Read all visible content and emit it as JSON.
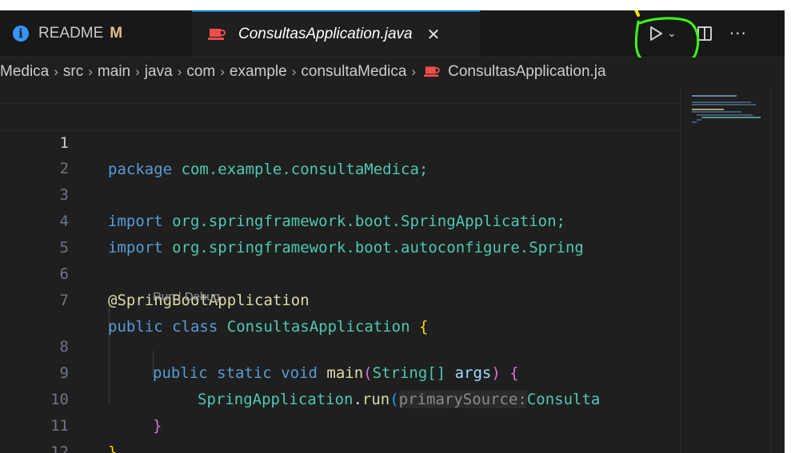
{
  "tabs": [
    {
      "label": "README",
      "badge": "M"
    },
    {
      "label": "ConsultasApplication.java",
      "close": "✕"
    }
  ],
  "actions": {
    "run_icon": "play-icon",
    "chevron": "⌄",
    "more": "···"
  },
  "breadcrumb": [
    "Medica",
    "src",
    "main",
    "java",
    "com",
    "example",
    "consultaMedica",
    "ConsultasApplication.ja"
  ],
  "breadcrumb_separator": "›",
  "gutter": {
    "line_numbers": [
      "1",
      "2",
      "3",
      "4",
      "5",
      "6",
      "7",
      "8",
      "9",
      "10",
      "11",
      "12"
    ],
    "active_line": "1"
  },
  "code": {
    "l1": {
      "kw": "package",
      "rest": " com.example.consultaMedica;"
    },
    "l3": {
      "kw": "import",
      "rest": " org.springframework.boot.SpringApplication;"
    },
    "l4": {
      "kw": "import",
      "rest": " org.springframework.boot.autoconfigure.Spring"
    },
    "l6": {
      "annotation": "@SpringBootApplication"
    },
    "l7": {
      "kw1": "public",
      "kw2": "class",
      "name": "ConsultasApplication",
      "brace": "{"
    },
    "codelens": {
      "run": "Run",
      "sep": " | ",
      "debug": "Debug"
    },
    "l8": {
      "kw1": "public",
      "kw2": "static",
      "kw3": "void",
      "fn": "main",
      "open": "(",
      "type": "String[]",
      "param": "args",
      "close": ")",
      "brace": "{"
    },
    "l9": {
      "cls": "SpringApplication",
      "dot": ".",
      "fn": "run",
      "open": "(",
      "hint": "primarySource:",
      "arg": "Consulta"
    },
    "l10": {
      "brace": "}"
    },
    "l11": {
      "brace": "}"
    }
  },
  "colors": {
    "editor_bg": "#1f1f1f",
    "keyword": "#569cd6",
    "type": "#4ec9b0",
    "function": "#dcdcaa",
    "highlight_annotation": "#39ff14",
    "java_icon": "#f14c4c"
  }
}
